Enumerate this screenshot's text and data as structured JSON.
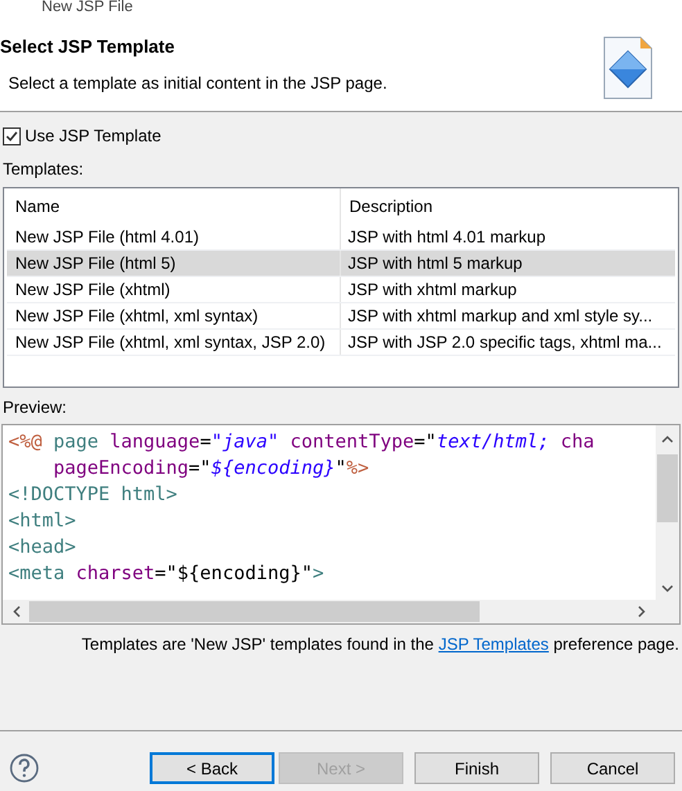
{
  "window": {
    "title": "New JSP File"
  },
  "header": {
    "title": "Select JSP Template",
    "description": "Select a template as initial content in the JSP page."
  },
  "use_template": {
    "label": "Use JSP Template",
    "checked": true
  },
  "templates_label": "Templates:",
  "table": {
    "columns": [
      "Name",
      "Description"
    ],
    "rows": [
      {
        "name": "New JSP File (html 4.01)",
        "description": "JSP with html 4.01 markup",
        "selected": false
      },
      {
        "name": "New JSP File (html 5)",
        "description": "JSP with html 5 markup",
        "selected": true
      },
      {
        "name": "New JSP File (xhtml)",
        "description": "JSP with xhtml markup",
        "selected": false
      },
      {
        "name": "New JSP File (xhtml, xml syntax)",
        "description": "JSP with xhtml markup and xml style sy...",
        "selected": false
      },
      {
        "name": "New JSP File (xhtml, xml syntax, JSP 2.0)",
        "description": "JSP with JSP 2.0 specific tags, xhtml ma...",
        "selected": false
      }
    ]
  },
  "preview_label": "Preview:",
  "preview": [
    [
      {
        "text": "<%@",
        "kind": "directive"
      },
      {
        "text": " page",
        "kind": "tag"
      },
      {
        "text": " language",
        "kind": "attr"
      },
      {
        "text": "=",
        "kind": "plain"
      },
      {
        "text": "\"java\"",
        "kind": "string"
      },
      {
        "text": " contentType",
        "kind": "attr"
      },
      {
        "text": "=",
        "kind": "plain"
      },
      {
        "text": "\"",
        "kind": "plain"
      },
      {
        "text": "text/html;",
        "kind": "string"
      },
      {
        "text": " cha",
        "kind": "attr"
      }
    ],
    [
      {
        "text": "    pageEncoding",
        "kind": "attr"
      },
      {
        "text": "=\"",
        "kind": "plain"
      },
      {
        "text": "${encoding}",
        "kind": "string"
      },
      {
        "text": "\"",
        "kind": "plain"
      },
      {
        "text": "%>",
        "kind": "directive"
      }
    ],
    [
      {
        "text": "<!DOCTYPE html>",
        "kind": "tag"
      }
    ],
    [
      {
        "text": "<html>",
        "kind": "tag"
      }
    ],
    [
      {
        "text": "<head>",
        "kind": "tag"
      }
    ],
    [
      {
        "text": "<meta",
        "kind": "tag"
      },
      {
        "text": " charset",
        "kind": "attr"
      },
      {
        "text": "=\"${encoding}\"",
        "kind": "plain"
      },
      {
        "text": ">",
        "kind": "tag"
      }
    ]
  ],
  "footer": {
    "before": "Templates are 'New JSP' templates found in the ",
    "link": "JSP Templates",
    "after": " preference page."
  },
  "buttons": [
    {
      "label": "< Back",
      "disabled": false,
      "focused": true
    },
    {
      "label": "Next >",
      "disabled": true,
      "focused": false
    },
    {
      "label": "Finish",
      "disabled": false,
      "focused": false
    },
    {
      "label": "Cancel",
      "disabled": false,
      "focused": false
    }
  ]
}
